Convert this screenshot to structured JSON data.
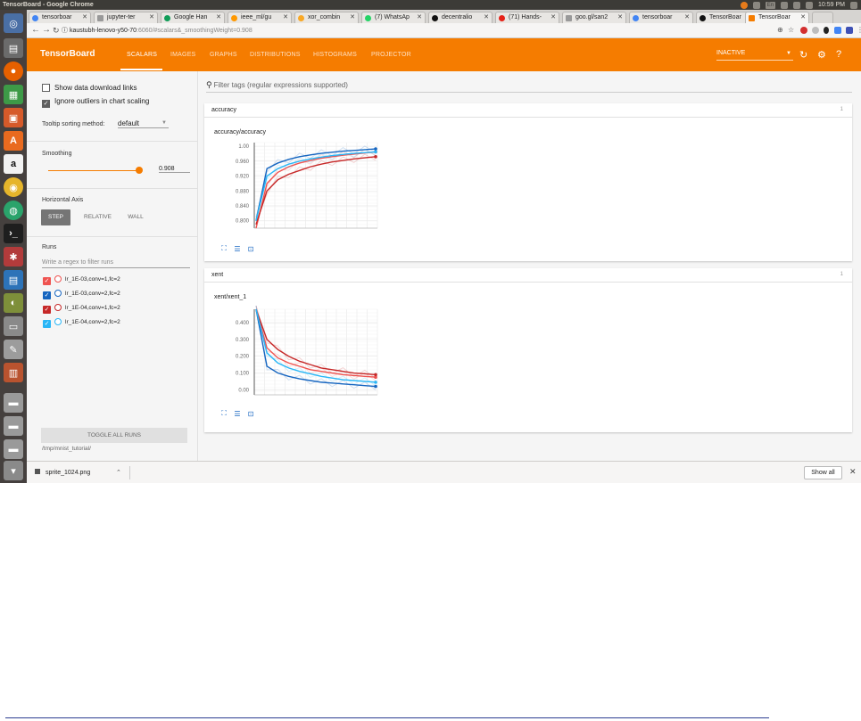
{
  "os": {
    "window_title": "TensorBoard - Google Chrome",
    "time": "10:59 PM",
    "lang": "En"
  },
  "browser": {
    "tabs": [
      {
        "label": "tensorboar"
      },
      {
        "label": "jupyter-ter"
      },
      {
        "label": "Google Han"
      },
      {
        "label": "ieee_ml/gu"
      },
      {
        "label": "xor_combin"
      },
      {
        "label": "(7) WhatsAp"
      },
      {
        "label": "decentralio"
      },
      {
        "label": "(71) Hands-"
      },
      {
        "label": "goo.gl/san2"
      },
      {
        "label": "tensorboar"
      },
      {
        "label": "TensorBoar"
      },
      {
        "label": "TensorBoar"
      }
    ],
    "url_host": "kaustubh-lenovo-y50-70",
    "url_path": ":6060/#scalars&_smoothingWeight=0.908"
  },
  "header": {
    "title": "TensorBoard",
    "nav": [
      "SCALARS",
      "IMAGES",
      "GRAPHS",
      "DISTRIBUTIONS",
      "HISTOGRAMS",
      "PROJECTOR"
    ],
    "inactive": "INACTIVE"
  },
  "sidebar": {
    "show_download_links": "Show data download links",
    "ignore_outliers": "Ignore outliers in chart scaling",
    "tooltip_label": "Tooltip sorting method:",
    "tooltip_value": "default",
    "smoothing_label": "Smoothing",
    "smoothing_value": "0.908",
    "smoothing_fraction": 0.908,
    "horizontal_axis_label": "Horizontal Axis",
    "axis_options": [
      "STEP",
      "RELATIVE",
      "WALL"
    ],
    "runs_label": "Runs",
    "runs_filter_placeholder": "Write a regex to filter runs",
    "runs": [
      {
        "label": "lr_1E-03,conv=1,fc=2",
        "checkbox_color": "#ef5350",
        "circle_color": "#ef5350"
      },
      {
        "label": "lr_1E-03,conv=2,fc=2",
        "checkbox_color": "#1565c0",
        "circle_color": "#1565c0"
      },
      {
        "label": "lr_1E-04,conv=1,fc=2",
        "checkbox_color": "#c62828",
        "circle_color": "#c62828"
      },
      {
        "label": "lr_1E-04,conv=2,fc=2",
        "checkbox_color": "#29b6f6",
        "circle_color": "#29b6f6"
      }
    ],
    "toggle_all": "TOGGLE ALL RUNS",
    "logdir": "/tmp/mnist_tutorial/"
  },
  "main": {
    "filter_placeholder": "Filter tags (regular expressions supported)",
    "cards": [
      {
        "title": "accuracy",
        "count": "1",
        "chart_title": "accuracy/accuracy"
      },
      {
        "title": "xent",
        "count": "1",
        "chart_title": "xent/xent_1"
      }
    ]
  },
  "chart_data": [
    {
      "type": "line",
      "title": "accuracy/accuracy",
      "y_ticks": [
        "1.00",
        "0.960",
        "0.920",
        "0.880",
        "0.840",
        "0.800"
      ],
      "ylim": [
        0.78,
        1.01
      ],
      "grid": true,
      "series": [
        {
          "color": "#ef5350",
          "values": [
            0.78,
            0.9,
            0.93,
            0.945,
            0.955,
            0.962,
            0.968,
            0.972,
            0.976,
            0.979,
            0.982,
            0.985
          ]
        },
        {
          "color": "#1565c0",
          "values": [
            0.8,
            0.94,
            0.955,
            0.965,
            0.972,
            0.977,
            0.981,
            0.984,
            0.987,
            0.989,
            0.991,
            0.993
          ]
        },
        {
          "color": "#c62828",
          "values": [
            0.79,
            0.88,
            0.91,
            0.925,
            0.935,
            0.945,
            0.952,
            0.958,
            0.962,
            0.966,
            0.969,
            0.972
          ]
        },
        {
          "color": "#29b6f6",
          "values": [
            0.8,
            0.92,
            0.94,
            0.952,
            0.96,
            0.966,
            0.971,
            0.975,
            0.978,
            0.981,
            0.983,
            0.985
          ]
        }
      ]
    },
    {
      "type": "line",
      "title": "xent/xent_1",
      "y_ticks": [
        "0.400",
        "0.300",
        "0.200",
        "0.100",
        "0.00"
      ],
      "ylim": [
        -0.03,
        0.48
      ],
      "grid": true,
      "series": [
        {
          "color": "#ef5350",
          "values": [
            0.48,
            0.25,
            0.19,
            0.16,
            0.14,
            0.12,
            0.11,
            0.1,
            0.09,
            0.085,
            0.08,
            0.075
          ]
        },
        {
          "color": "#1565c0",
          "values": [
            0.48,
            0.14,
            0.1,
            0.08,
            0.065,
            0.055,
            0.045,
            0.04,
            0.035,
            0.03,
            0.025,
            0.02
          ]
        },
        {
          "color": "#c62828",
          "values": [
            0.48,
            0.3,
            0.24,
            0.2,
            0.17,
            0.15,
            0.13,
            0.12,
            0.11,
            0.1,
            0.095,
            0.09
          ]
        },
        {
          "color": "#29b6f6",
          "values": [
            0.48,
            0.22,
            0.16,
            0.13,
            0.11,
            0.095,
            0.08,
            0.07,
            0.06,
            0.055,
            0.05,
            0.045
          ]
        }
      ]
    }
  ],
  "downloads": {
    "file": "sprite_1024.png",
    "show_all": "Show all"
  }
}
